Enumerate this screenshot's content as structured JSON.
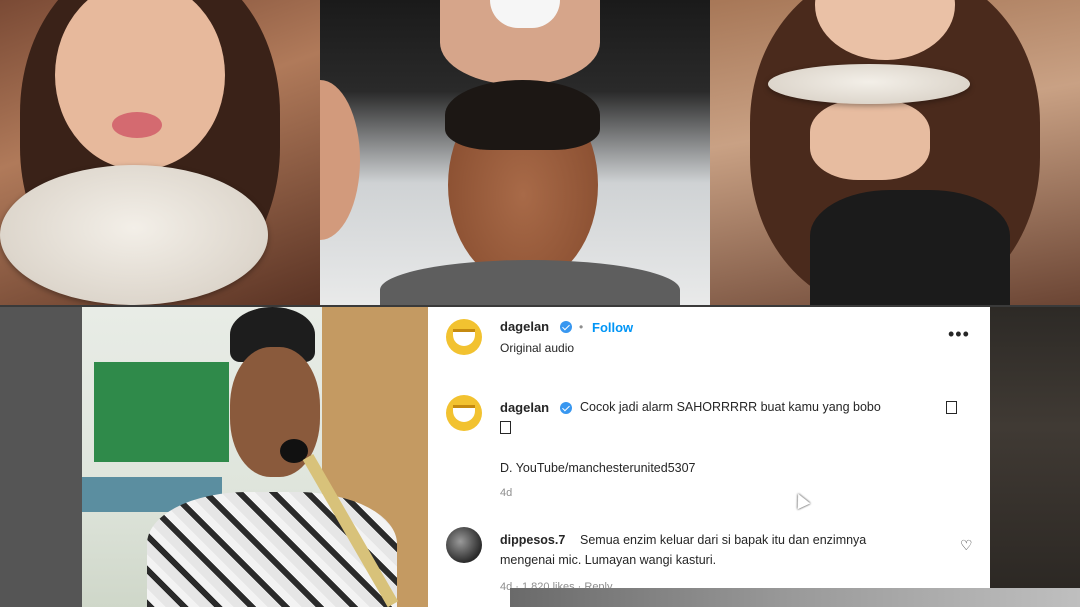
{
  "post": {
    "author": "dagelan",
    "follow_label": "Follow",
    "separator": "•",
    "audio": "Original audio",
    "more_icon": "more-dots-icon",
    "caption": {
      "username": "dagelan",
      "text": "Cocok jadi alarm SAHORRRRR buat kamu yang bobo",
      "source": "D. YouTube/manchesterunited5307",
      "time": "4d"
    },
    "comment": {
      "username": "dippesos.7",
      "text_line1": "Semua enzim keluar dari si bapak itu dan enzimnya",
      "text_line2": "mengenai mic. Lumayan wangi kasturi.",
      "meta": "4d · 1,820 likes · Reply",
      "like_icon": "heart-icon"
    }
  },
  "colors": {
    "link_blue": "#0095f6",
    "verified_blue": "#3897f0",
    "avatar_yellow": "#f2c230"
  }
}
